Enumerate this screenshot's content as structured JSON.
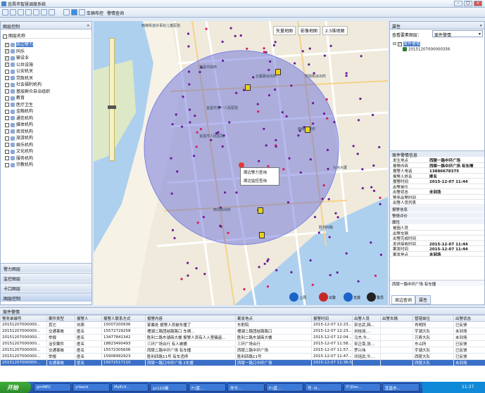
{
  "window": {
    "title": "宜昌市智慧调度系统"
  },
  "toolbar": {
    "car_label": "车辆布控",
    "alarm_label": "警情查询"
  },
  "left_panel": {
    "header": "图层控制",
    "column": "图层名称",
    "layers": [
      {
        "label": "周边警力",
        "checked": true,
        "selected": true
      },
      {
        "label": "同乐",
        "checked": true
      },
      {
        "label": "输设业",
        "checked": true
      },
      {
        "label": "公共设施",
        "checked": true
      },
      {
        "label": "公安机关",
        "checked": false
      },
      {
        "label": "党政机关",
        "checked": false
      },
      {
        "label": "社会福利机构",
        "checked": false
      },
      {
        "label": "基层群众自治组织",
        "checked": false
      },
      {
        "label": "教育",
        "checked": false
      },
      {
        "label": "医疗卫生",
        "checked": false
      },
      {
        "label": "金融机构",
        "checked": false
      },
      {
        "label": "通信机构",
        "checked": false
      },
      {
        "label": "媒体机构",
        "checked": false
      },
      {
        "label": "商贸机构",
        "checked": false
      },
      {
        "label": "旅游机构",
        "checked": false
      },
      {
        "label": "娱乐机构",
        "checked": false
      },
      {
        "label": "文化机构",
        "checked": false
      },
      {
        "label": "服务机构",
        "checked": false
      },
      {
        "label": "宗教机构",
        "checked": false
      }
    ],
    "accordion": [
      "警力图层",
      "监控图层",
      "卡口图层",
      "图层控制"
    ]
  },
  "map": {
    "tabs": [
      "矢量地图",
      "影像地图",
      "2.5维地图"
    ],
    "context_menu": [
      "周边警力查询",
      "周边监控查询"
    ],
    "labels": [
      "西陵街道办事处儿童医院",
      "宜昌市政府",
      "云集路派出所",
      "宜昌市第一人民医院",
      "学院街派出所",
      "西坝派出所",
      "宜昌市人民医院",
      "西陵区政府",
      "九州大厦",
      "胜利四路"
    ],
    "bottom_tools": [
      "上周",
      "出警",
      "支援",
      "警员"
    ]
  },
  "right_panel": {
    "header": "属性",
    "query_label": "查看要素图层：",
    "query_value": "案件警情",
    "tree_root": "案件警情",
    "tree_child": "20151207000000356",
    "info_header": "案件警情信息",
    "info": [
      {
        "k": "发生地点",
        "v": "西陵一路中环广场"
      },
      {
        "k": "报警内容",
        "v": "西陵一路中环广场 有车撞"
      },
      {
        "k": "报警人电话",
        "v": "13886678375"
      },
      {
        "k": "报警人姓名",
        "v": "匿名"
      },
      {
        "k": "报警时间",
        "v": "2015-12-07 11:44"
      },
      {
        "k": "出警单位",
        "v": ""
      },
      {
        "k": "出警状态",
        "v": "未到场"
      },
      {
        "k": "警务出警时间",
        "v": ""
      },
      {
        "k": "出警人员列表",
        "v": ""
      }
    ],
    "sections": [
      "报警信息",
      "警情评价",
      "属性"
    ],
    "extra": [
      {
        "k": "被困人员",
        "v": ""
      },
      {
        "k": "出警车辆",
        "v": ""
      },
      {
        "k": "出警完成时间",
        "v": ""
      },
      {
        "k": "发送接收时间",
        "v": "2015-12-07 11:44"
      },
      {
        "k": "案发时间",
        "v": "2015-12-07 11:44"
      },
      {
        "k": "案发地点",
        "v": "未到场"
      }
    ],
    "summary": "西陵一路中环广场 有车撞",
    "tabs": [
      "周边查询",
      "属性"
    ]
  },
  "bottom": {
    "header": "案件警情",
    "columns": [
      "警务单编号",
      "案件类型",
      "报警人",
      "报警人联系方式",
      "报警内容",
      "案发地点",
      "报警时间",
      "出警人员",
      "出警车辆",
      "管辖单位",
      "出警状态"
    ],
    "rows": [
      [
        "20151207000000...",
        "其它",
        "刘燕",
        "15007200936",
        "家暴处 报警人员被车撞了",
        "东职院",
        "2015-12-07 12:23...",
        "宋志武,韩...",
        "",
        "肖明所",
        "已反馈"
      ],
      [
        "20151207000000...",
        "交通事故",
        "匿名",
        "15572729258",
        "槽湖二路团结路路口 车祸...",
        "槽湖二路团结路路口",
        "2015-12-07 12:23...",
        "刘桂丽,...",
        "",
        "宇湖大队",
        "未到场"
      ],
      [
        "20151207000000...",
        "举报",
        "匿名",
        "13477841342",
        "胜利二路东湖商大楼 报警人员有人入室骗盗...",
        "胜利二路东湖商大楼",
        "2015-12-07 12:04...",
        "马杰,牛...",
        "",
        "万寿大队",
        "未到场"
      ],
      [
        "20151207000000...",
        "治安案件",
        "匿名",
        "18823490493",
        "三环广场合行 有人被捅",
        "三环广场合行",
        "2015-12-07 11:58...",
        "宋正南,张...",
        "",
        "东山所",
        "已反馈"
      ],
      [
        "20151207000000...",
        "交通事故",
        "匿名",
        "15572305606",
        "西陵二路中环广场 有车撞",
        "西陵二路中环广场",
        "2015-12-07 11:57...",
        "罗兴伟",
        "",
        "宇湖大队",
        "已反馈"
      ],
      [
        "20151207000000...",
        "举报",
        "匿名",
        "15908992923",
        "胜利四路11号 有车违停",
        "胜利四路11号",
        "2015-12-07 11:47...",
        "邓培武,牛...",
        "",
        "西陵大队",
        "已反馈"
      ],
      [
        "20151207000000...",
        "交通事故",
        "匿名",
        "15072517110",
        "西陵一路口中环广场 2车撞",
        "西陵一路口中环广场",
        "2015-12-07 11:36:5...",
        "",
        "",
        "西陵大队",
        "未到场"
      ]
    ],
    "selected_row": 6
  },
  "taskbar": {
    "start": "开始",
    "tasks": [
      "gmNEC",
      "yrback",
      "MyEcli..",
      "yc110编",
      "F:\\蓝...",
      "命令...",
      "F:\\蓝...",
      "号 -H...",
      "F:\\Doc...",
      "宜昌市..."
    ],
    "clock": "11:37"
  }
}
